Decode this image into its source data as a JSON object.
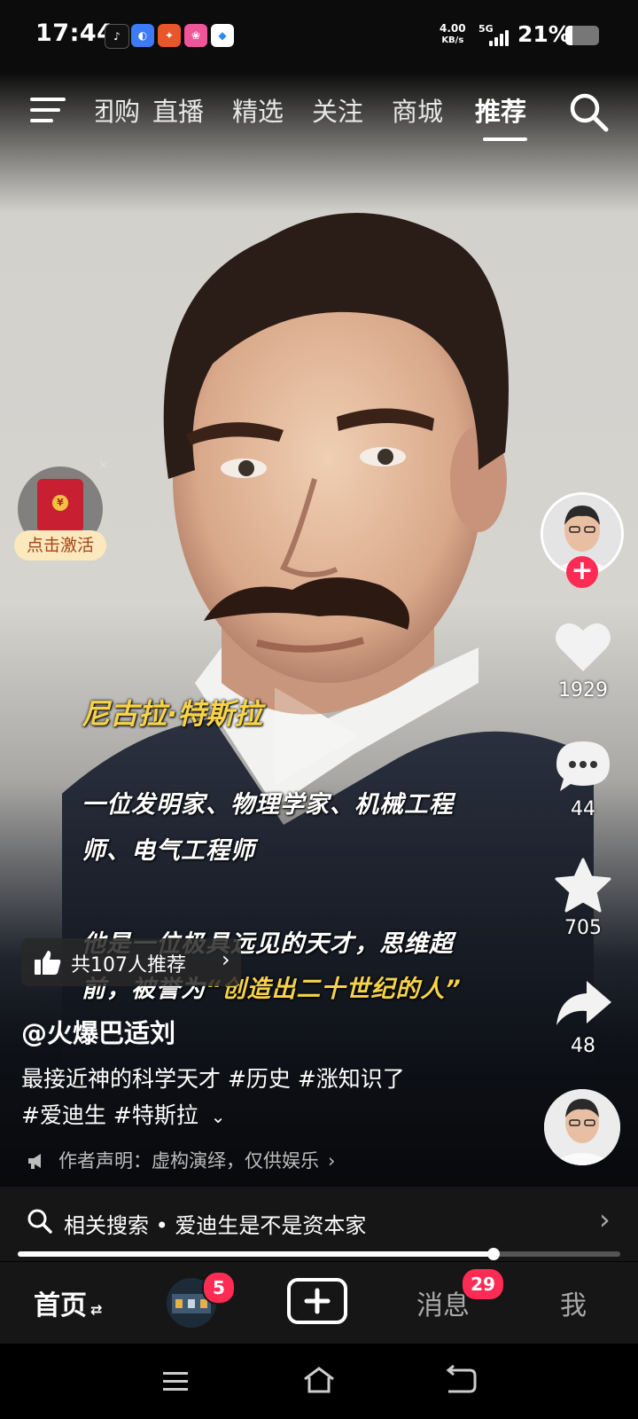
{
  "status_bar": {
    "time": "17:44",
    "net_speed_value": "4.00",
    "net_speed_unit": "KB/s",
    "signal": "5G",
    "battery": "21%",
    "battery_level": 0.21,
    "app_icons": [
      "tiktok-lite-icon",
      "browser-icon",
      "game-app-icon",
      "photo-app-icon",
      "app-store-icon"
    ]
  },
  "top_nav": {
    "tabs": [
      "团购",
      "直播",
      "精选",
      "关注",
      "商城",
      "推荐"
    ],
    "active_tab": "推荐"
  },
  "red_packet": {
    "label": "点击激活",
    "close": "×",
    "seal": "¥"
  },
  "caption": {
    "name": "尼古拉·特斯拉",
    "line1": "一位发明家、物理学家、机械工程",
    "line2": "师、电气工程师",
    "line3": "他是一位极具远见的天才，思维超",
    "line4_prefix": "前，被誉为",
    "line4_highlight": "“创造出二十世纪的人”"
  },
  "actions": {
    "likes": "1929",
    "comments": "44",
    "favorites": "705",
    "shares": "48",
    "follow": "+"
  },
  "video_info": {
    "recommend": "共107人推荐",
    "username": "@火爆巴适刘",
    "description_line1": "最接近神的科学天才 #历史 #涨知识了",
    "description_line2": "#爱迪生 #特斯拉",
    "disclaimer": "作者声明：虚构演绎，仅供娱乐"
  },
  "related_search": {
    "text": "相关搜索 • 爱迪生是不是资本家"
  },
  "progress": 0.79,
  "bottom_nav": {
    "home": "首页",
    "friends_badge": "5",
    "messages": "消息",
    "messages_badge": "29",
    "me": "我"
  }
}
